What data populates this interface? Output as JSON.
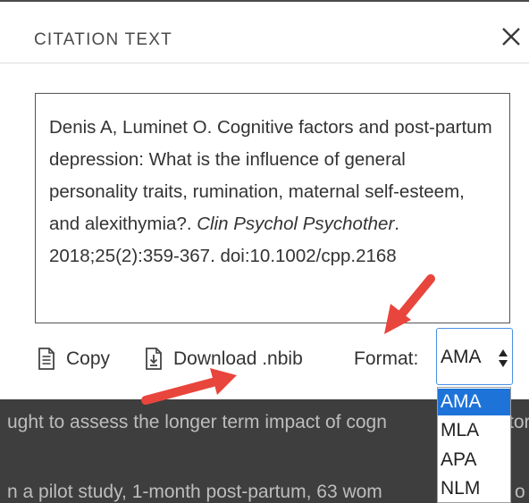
{
  "dialog": {
    "title": "CITATION TEXT",
    "close_icon": "close-icon"
  },
  "citation": {
    "text_before_journal": "Denis A, Luminet O. Cognitive factors and post-partum depression: What is the influence of general personality traits, rumination, maternal self-esteem, and alexithymia?. ",
    "journal": "Clin Psychol Psychother",
    "text_after_journal": ". 2018;25(2):359-367. doi:10.1002/cpp.2168"
  },
  "actions": {
    "copy_label": "Copy",
    "copy_icon": "document-copy-icon",
    "download_label": "Download .nbib",
    "download_icon": "download-file-icon",
    "format_label": "Format:",
    "format_selected": "AMA",
    "format_options": [
      "AMA",
      "MLA",
      "APA",
      "NLM"
    ]
  },
  "background_text": {
    "line1": "ught to assess the longer term impact of cogn",
    "line1_tail": "tor",
    "line2": "n a pilot study, 1-month post-partum, 63 wom",
    "line2_tail": "o"
  },
  "colors": {
    "annotation_arrow": "#e8453c",
    "select_highlight": "#1e73d8",
    "backdrop": "#3e3e3e"
  }
}
